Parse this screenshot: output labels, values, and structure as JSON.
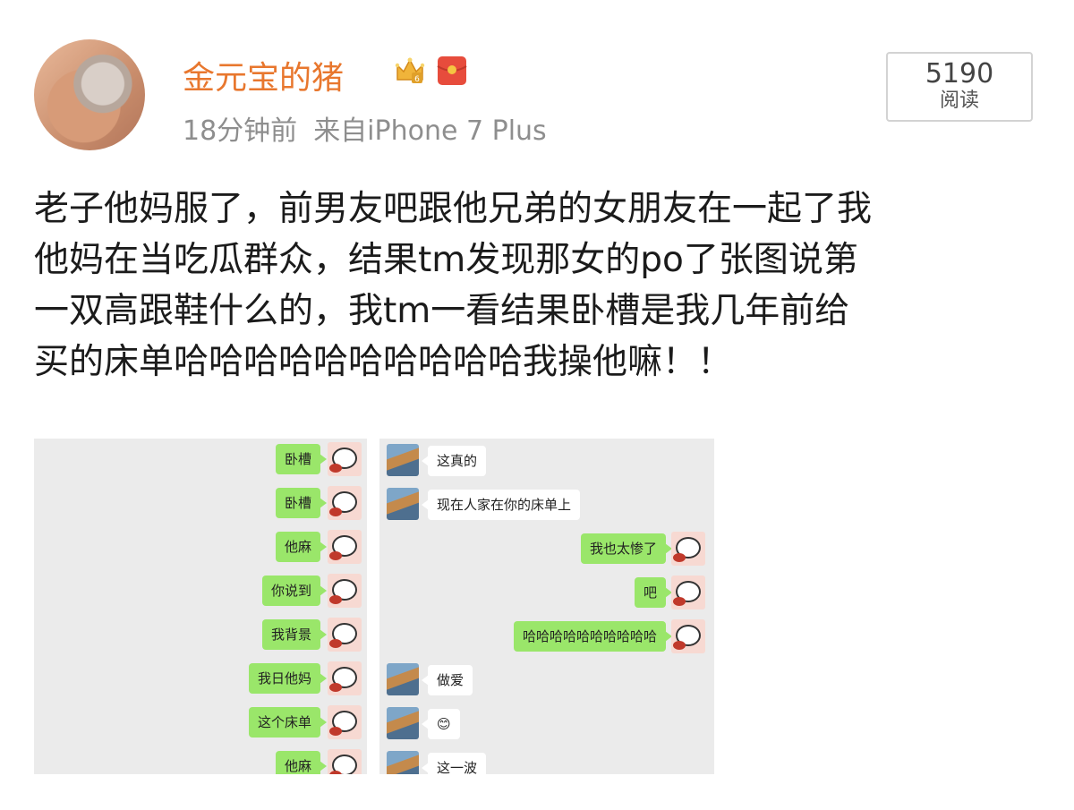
{
  "post": {
    "username": "金元宝的猪",
    "time": "18分钟前",
    "source": "来自iPhone 7 Plus",
    "reads_count": "5190",
    "reads_label": "阅读",
    "text_lines": [
      "老子他妈服了，前男友吧跟他兄弟的女朋友在一起了我",
      "他妈在当吃瓜群众，结果tm发现那女的po了张图说第",
      "一双高跟鞋什么的，我tm一看结果卧槽是我几年前给",
      "买的床单哈哈哈哈哈哈哈哈哈哈我操他嘛！！"
    ]
  },
  "icons": {
    "crown": "crown-vip-icon",
    "red_packet": "red-packet-icon"
  },
  "chat_left": [
    {
      "text": "卧槽"
    },
    {
      "text": "卧槽"
    },
    {
      "text": "他麻"
    },
    {
      "text": "你说到"
    },
    {
      "text": "我背景"
    },
    {
      "text": "我日他妈"
    },
    {
      "text": "这个床单"
    },
    {
      "text": "他麻"
    }
  ],
  "chat_right": [
    {
      "side": "them",
      "text": "这真的"
    },
    {
      "side": "them",
      "text": "现在人家在你的床单上"
    },
    {
      "side": "me",
      "text": "我也太惨了"
    },
    {
      "side": "me",
      "text": "吧"
    },
    {
      "side": "me",
      "text": "哈哈哈哈哈哈哈哈哈哈"
    },
    {
      "side": "them",
      "text": "做爱"
    },
    {
      "side": "them",
      "text": "😊"
    },
    {
      "side": "them",
      "text": "这一波"
    }
  ],
  "colors": {
    "username": "#e8772e",
    "meta": "#8e8e8e",
    "wechat_green": "#9ae66a",
    "chat_bg": "#ebebeb"
  }
}
